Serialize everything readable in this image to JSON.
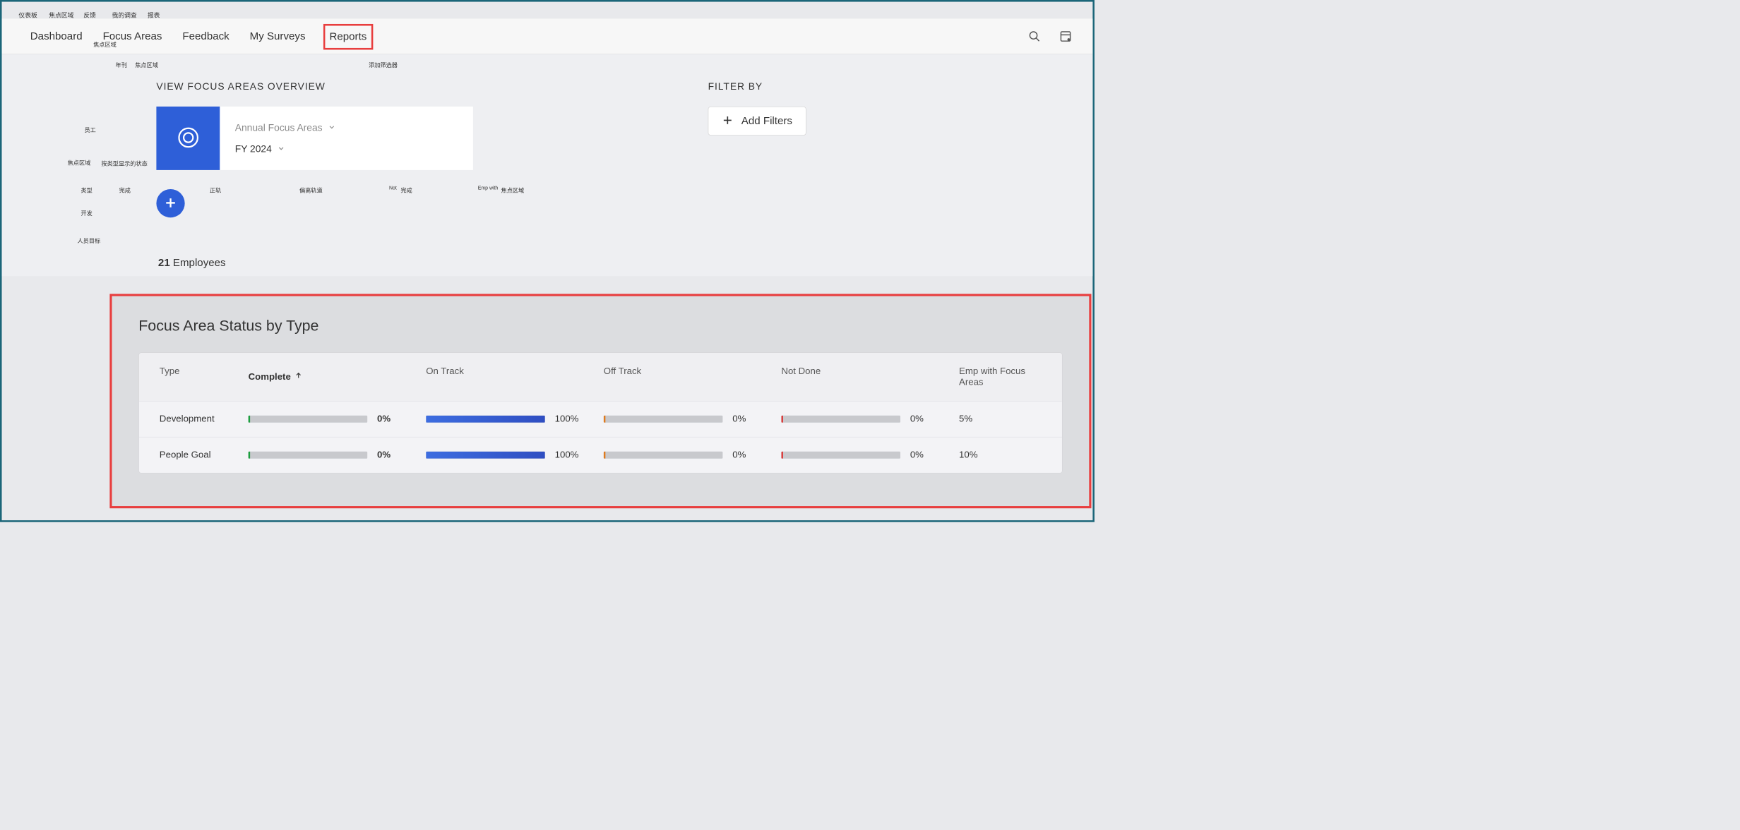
{
  "anno_top": {
    "dashboard": "仪表板",
    "focus_areas": "焦点区域",
    "feedback": "反馈",
    "my_surveys": "我的调查",
    "reports": "报表"
  },
  "nav": {
    "dashboard": "Dashboard",
    "focus_areas": "Focus Areas",
    "feedback": "Feedback",
    "my_surveys": "My Surveys",
    "reports": "Reports",
    "focus_sub": "焦点区域"
  },
  "anno_left": {
    "yearly": "年刊",
    "focus_zone": "焦点区域",
    "employees": "员工",
    "focus_area": "焦点区域",
    "status_by_type": "按类型显示的状态",
    "type": "类型",
    "complete": "完成",
    "ontrack": "正轨",
    "offtrack": "偏离轨道",
    "not": "Not",
    "done": "完成",
    "emp_with": "Emp with",
    "focus_zone2": "焦点区域",
    "development": "开发",
    "people_goal": "人员目标",
    "add_filters": "添加筛选器"
  },
  "section": {
    "title": "VIEW FOCUS AREAS OVERVIEW",
    "dd_primary": "Annual Focus Areas",
    "dd_secondary": "FY 2024"
  },
  "employees": {
    "count": "21",
    "label": " Employees"
  },
  "filter": {
    "title": "FILTER BY",
    "button": "Add Filters"
  },
  "card": {
    "title": "Focus Area Status by Type",
    "headers": {
      "type": "Type",
      "complete": "Complete",
      "ontrack": "On Track",
      "offtrack": "Off Track",
      "notdone": "Not Done",
      "emp": "Emp with Focus Areas"
    },
    "rows": [
      {
        "type": "Development",
        "complete": "0%",
        "ontrack": "100%",
        "offtrack": "0%",
        "notdone": "0%",
        "emp": "5%"
      },
      {
        "type": "People Goal",
        "complete": "0%",
        "ontrack": "100%",
        "offtrack": "0%",
        "notdone": "0%",
        "emp": "10%"
      }
    ]
  },
  "chart_data": {
    "type": "table",
    "title": "Focus Area Status by Type",
    "columns": [
      "Type",
      "Complete",
      "On Track",
      "Off Track",
      "Not Done",
      "Emp with Focus Areas"
    ],
    "rows": [
      {
        "Type": "Development",
        "Complete": 0,
        "On Track": 100,
        "Off Track": 0,
        "Not Done": 0,
        "Emp with Focus Areas": 5
      },
      {
        "Type": "People Goal",
        "Complete": 0,
        "On Track": 100,
        "Off Track": 0,
        "Not Done": 0,
        "Emp with Focus Areas": 10
      }
    ]
  }
}
